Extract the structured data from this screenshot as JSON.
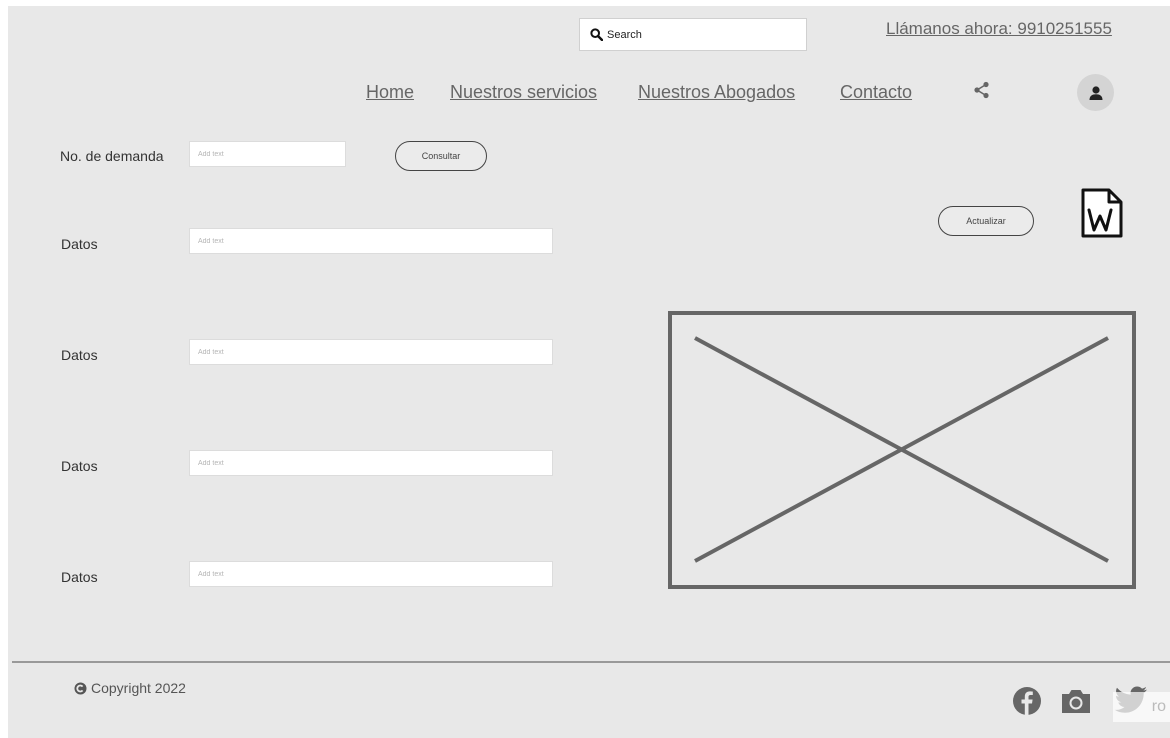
{
  "header": {
    "search_placeholder": "Search",
    "call_now": "Llámanos ahora: 9910251555"
  },
  "nav": {
    "home": "Home",
    "services": "Nuestros servicios",
    "lawyers": "Nuestros Abogados",
    "contact": "Contacto"
  },
  "form": {
    "demand_label": "No. de demanda",
    "demand_placeholder": "Add text",
    "consult_button": "Consultar",
    "update_button": "Actualizar",
    "rows": [
      {
        "label": "Datos",
        "placeholder": "Add text"
      },
      {
        "label": "Datos",
        "placeholder": "Add text"
      },
      {
        "label": "Datos",
        "placeholder": "Add text"
      },
      {
        "label": "Datos",
        "placeholder": "Add text"
      }
    ]
  },
  "footer": {
    "copyright": "Copyright 2022",
    "watermark": "ro"
  },
  "icons": {
    "search": "search-icon",
    "share": "share-icon",
    "avatar": "user-icon",
    "word": "word-document-icon",
    "copyright": "copyright-icon",
    "facebook": "facebook-icon",
    "camera": "camera-icon",
    "twitter": "twitter-icon"
  },
  "colors": {
    "background": "#e8e8e8",
    "link": "#666666",
    "placeholder_frame": "#666666"
  }
}
